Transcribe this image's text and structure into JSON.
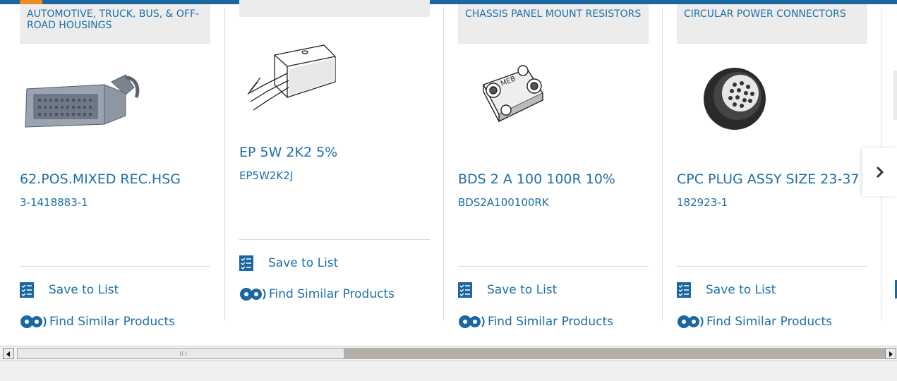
{
  "carousel": {
    "cards": [
      {
        "category": "AUTOMOTIVE, TRUCK, BUS, & OFF-ROAD HOUSINGS",
        "title": "62.POS.MIXED REC.HSG",
        "part_number": "3-1418883-1",
        "save_label": "Save to List",
        "similar_label": "Find Similar Products",
        "image": "automotive-housing-image"
      },
      {
        "category": "",
        "title": "EP 5W 2K2 5%",
        "part_number": "EP5W2K2J",
        "save_label": "Save to List",
        "similar_label": "Find Similar Products",
        "image": "resistor-sketch-image"
      },
      {
        "category": "CHASSIS PANEL MOUNT RESISTORS",
        "title": "BDS 2 A 100 100R 10%",
        "part_number": "BDS2A100100RK",
        "save_label": "Save to List",
        "similar_label": "Find Similar Products",
        "image": "chassis-resistor-image"
      },
      {
        "category": "CIRCULAR POWER CONNECTORS",
        "title": "CPC PLUG ASSY SIZE 23-37",
        "part_number": "182923-1",
        "save_label": "Save to List",
        "similar_label": "Find Similar Products",
        "image": "circular-connector-image"
      }
    ],
    "next_icon": "chevron-right-icon"
  },
  "colors": {
    "brand_blue": "#1b67a0",
    "link_blue": "#1e6fa8",
    "accent_orange": "#f08a22",
    "category_bg": "#ececec"
  }
}
